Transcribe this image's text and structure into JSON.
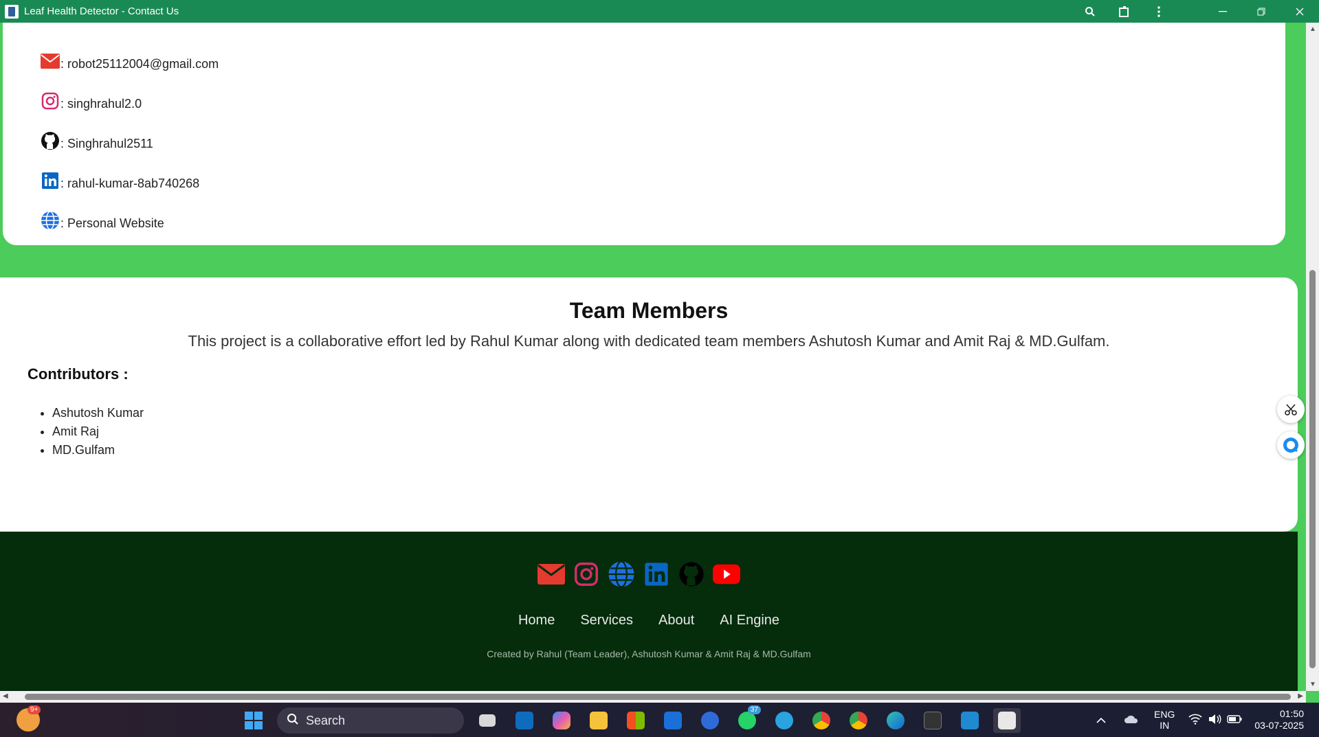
{
  "window": {
    "title": "Leaf Health Detector - Contact Us"
  },
  "contact": [
    {
      "icon": "envelope-icon",
      "text": ": robot25112004@gmail.com"
    },
    {
      "icon": "instagram-icon",
      "text": ": singhrahul2.0"
    },
    {
      "icon": "github-icon",
      "text": ": Singhrahul2511"
    },
    {
      "icon": "linkedin-icon",
      "text": ": rahul-kumar-8ab740268"
    },
    {
      "icon": "globe-icon",
      "text": ": Personal Website"
    }
  ],
  "team": {
    "title": "Team Members",
    "description": "This project is a collaborative effort led by Rahul Kumar along with dedicated team members Ashutosh Kumar and Amit Raj & MD.Gulfam.",
    "contributors_heading": "Contributors :",
    "contributors": [
      "Ashutosh Kumar",
      "Amit Raj",
      "MD.Gulfam"
    ]
  },
  "footer": {
    "nav": [
      "Home",
      "Services",
      "About",
      "AI Engine"
    ],
    "credit": "Created by Rahul (Team Leader), Ashutosh Kumar & Amit Raj & MD.Gulfam"
  },
  "taskbar": {
    "search_label": "Search",
    "weather_badge": "9+",
    "whatsapp_badge": "37",
    "lang_top": "ENG",
    "lang_bottom": "IN",
    "time": "01:50",
    "date": "03-07-2025"
  },
  "colors": {
    "title_bar": "#1a8a55",
    "page_bg": "#4ccc5b",
    "footer_bg": "#052c0b"
  }
}
